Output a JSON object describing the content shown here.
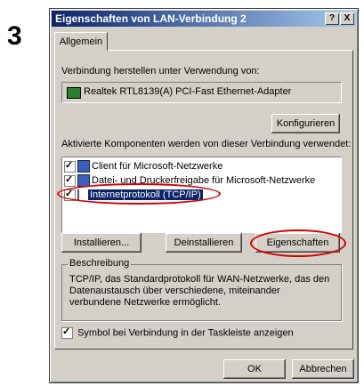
{
  "step_number": "3",
  "window": {
    "title": "Eigenschaften von LAN-Verbindung 2",
    "help_label": "?",
    "close_label": "X"
  },
  "tabs": [
    {
      "label": "Allgemein"
    }
  ],
  "connect_using_label": "Verbindung herstellen unter Verwendung von:",
  "adapter_name": "Realtek RTL8139(A) PCI-Fast Ethernet-Adapter",
  "configure_label": "Konfigurieren",
  "components_label": "Aktivierte Komponenten werden von dieser Verbindung verwendet:",
  "components": [
    {
      "label": "Client für Microsoft-Netzwerke",
      "checked": true,
      "icon": "network-client-icon"
    },
    {
      "label": "Datei- und Druckerfreigabe für Microsoft-Netzwerke",
      "checked": true,
      "icon": "file-printer-sharing-icon"
    },
    {
      "label": "Internetprotokoll (TCP/IP)",
      "checked": true,
      "icon": "protocol-icon",
      "selected": true
    }
  ],
  "buttons": {
    "install": "Installieren...",
    "uninstall": "Deinstallieren",
    "properties": "Eigenschaften"
  },
  "description": {
    "title": "Beschreibung",
    "text": "TCP/IP, das Standardprotokoll für WAN-Netzwerke, das den Datenaustausch über verschiedene, miteinander verbundene Netzwerke ermöglicht."
  },
  "taskbar_option": {
    "label": "Symbol bei Verbindung in der Taskleiste anzeigen",
    "checked": true
  },
  "footer": {
    "ok": "OK",
    "cancel": "Abbrechen"
  },
  "colors": {
    "titlebar": "#0a246a",
    "highlight": "#0a246a",
    "annotation": "#d40000"
  }
}
